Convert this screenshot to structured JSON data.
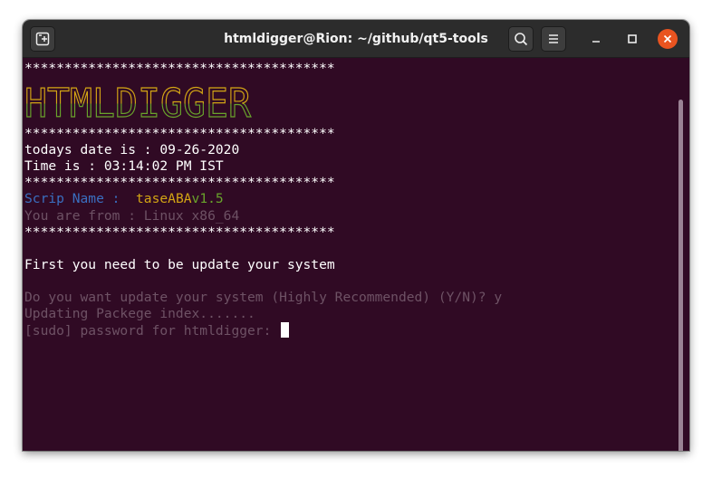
{
  "window": {
    "title": "htmldigger@Rion: ~/github/qt5-tools",
    "buttons": {
      "new_tab_icon": "new-tab-icon",
      "search_icon": "search-icon",
      "menu_icon": "hamburger-menu-icon",
      "minimize_icon": "minimize-icon",
      "maximize_icon": "maximize-icon",
      "close_icon": "close-icon"
    }
  },
  "colors": {
    "terminal_bg": "#300a24",
    "close_button": "#e95420",
    "banner_top": "#d3a514",
    "banner_bottom": "#69a42b",
    "dim_text": "#6e5265",
    "blue_label": "#3a6fc0"
  },
  "terminal": {
    "separator": "***************************************",
    "banner_text": "HTMLDIGGER",
    "date_line": "todays date is : 09-26-2020",
    "time_line": "Time is : 03:14:02 PM IST",
    "script_label": "Scrip Name :  ",
    "script_name": "taseABA",
    "script_version": "v1.5",
    "from_line": "You are from : Linux x86_64",
    "update_notice": "First you need to be update your system",
    "prompt_line": "Do you want update your system (Highly Recommended) (Y/N)? y",
    "updating_line": "Updating Packege index.......",
    "sudo_line": "[sudo] password for htmldigger: "
  }
}
